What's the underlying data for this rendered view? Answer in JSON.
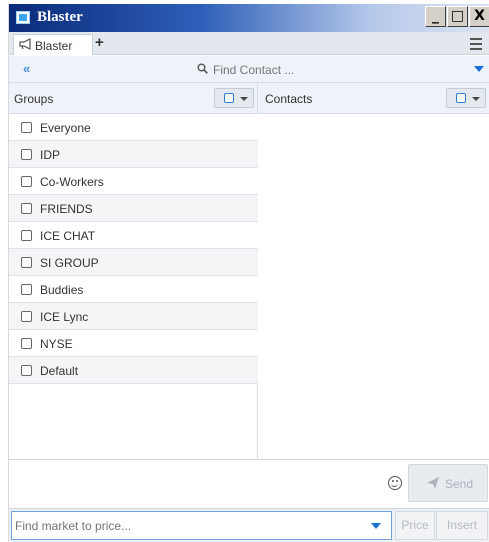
{
  "window": {
    "title": "Blaster",
    "buttons": {
      "minimize": "_",
      "maximize": "□",
      "close": "X"
    }
  },
  "tabs": {
    "items": [
      {
        "label": "Blaster",
        "icon": "megaphone-icon"
      }
    ],
    "add_label": "+",
    "menu_icon": "hamburger-menu-icon"
  },
  "search": {
    "collapse_label": "«",
    "placeholder": "Find Contact ..."
  },
  "groups": {
    "title": "Groups",
    "items": [
      {
        "label": "Everyone",
        "checked": false
      },
      {
        "label": "IDP",
        "checked": false
      },
      {
        "label": "Co-Workers",
        "checked": false
      },
      {
        "label": "FRIENDS",
        "checked": false
      },
      {
        "label": "ICE CHAT",
        "checked": false
      },
      {
        "label": "SI GROUP",
        "checked": false
      },
      {
        "label": "Buddies",
        "checked": false
      },
      {
        "label": "ICE Lync",
        "checked": false
      },
      {
        "label": "NYSE",
        "checked": false
      },
      {
        "label": "Default",
        "checked": false
      }
    ]
  },
  "contacts": {
    "title": "Contacts",
    "items": []
  },
  "compose": {
    "send_label": "Send",
    "emoji_icon": "smiley-icon"
  },
  "footer": {
    "market_placeholder": "Find market to price...",
    "price_label": "Price",
    "insert_label": "Insert"
  },
  "colors": {
    "accent": "#1a6fd6",
    "title_gradient_start": "#0a2a7a",
    "panel_header_bg": "#eef3f9"
  }
}
